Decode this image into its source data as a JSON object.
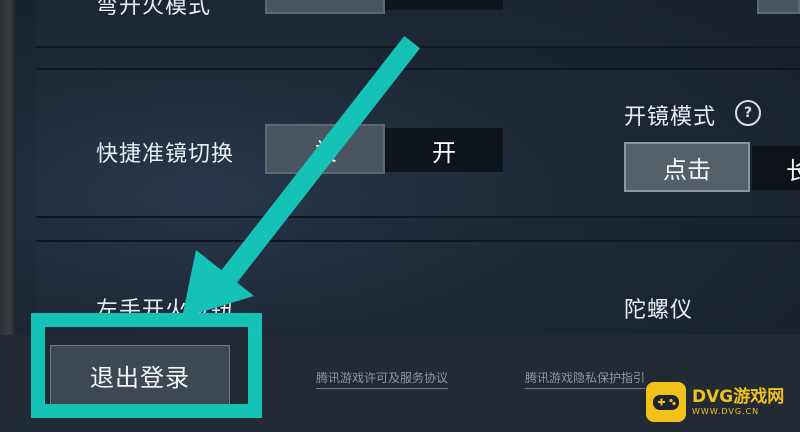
{
  "settings": {
    "row1": {
      "label": "弯开火模式"
    },
    "quick_scope": {
      "label": "快捷准镜切换",
      "option_off": "关",
      "option_on": "开"
    },
    "scope_mode": {
      "label": "开镜模式",
      "option_tap": "点击",
      "option_hold": "长"
    },
    "left_fire": {
      "label": "左手开火按钮"
    },
    "gyroscope": {
      "label": "陀螺仪"
    }
  },
  "footer": {
    "logout_label": "退出登录",
    "license_link": "腾讯游戏许可及服务协议",
    "privacy_link": "腾讯游戏隐私保护指引"
  },
  "watermark": {
    "brand": "DVG游戏网",
    "domain": "WWW.DVG.CN"
  },
  "colors": {
    "annotation": "#14c2b6",
    "brand": "#f2c21b"
  },
  "icons": {
    "help": "question-circle-icon",
    "arrow": "annotation-arrow",
    "logo": "gamepad-icon"
  }
}
